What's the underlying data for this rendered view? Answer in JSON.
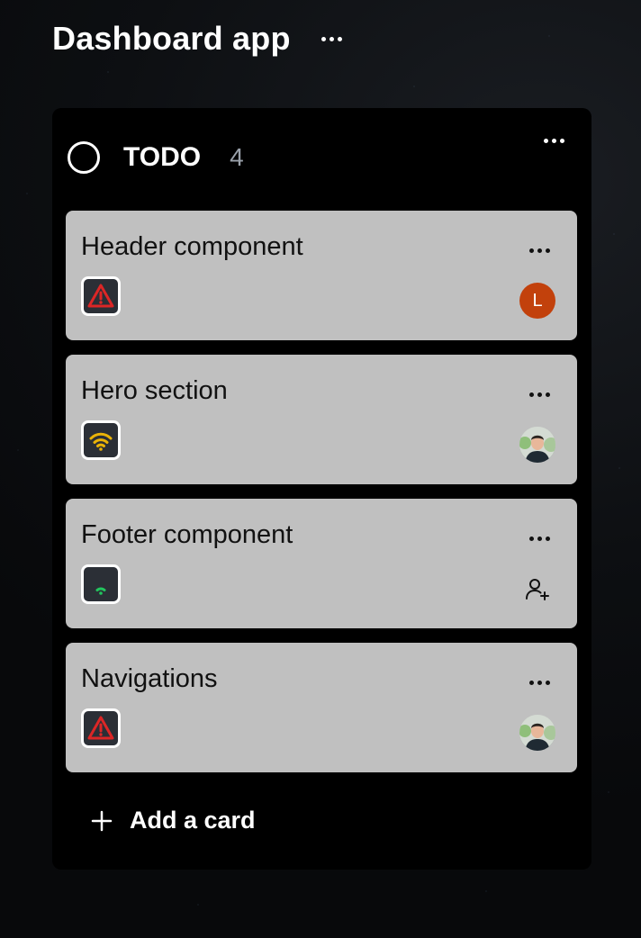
{
  "board": {
    "title": "Dashboard app"
  },
  "column": {
    "title": "TODO",
    "count": "4"
  },
  "cards": [
    {
      "title": "Header component",
      "priority": "urgent",
      "priority_icon": "warning-icon",
      "assignee": {
        "type": "letter",
        "initial": "L",
        "color": "#c2410c"
      }
    },
    {
      "title": "Hero section",
      "priority": "high",
      "priority_icon": "signal-high-icon",
      "assignee": {
        "type": "photo"
      }
    },
    {
      "title": "Footer component",
      "priority": "low",
      "priority_icon": "signal-low-icon",
      "assignee": {
        "type": "unassigned",
        "icon": "add-user-icon"
      }
    },
    {
      "title": "Navigations",
      "priority": "urgent",
      "priority_icon": "warning-icon",
      "assignee": {
        "type": "photo"
      }
    }
  ],
  "add_card": {
    "label": "Add a card"
  },
  "colors": {
    "card_bg": "#c0c0c0",
    "column_bg": "#000000",
    "urgent": "#dc2626",
    "high": "#eab308",
    "low": "#22c55e",
    "count": "#9aa1aa"
  }
}
